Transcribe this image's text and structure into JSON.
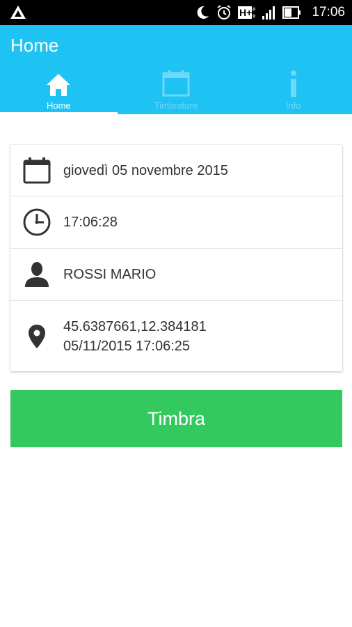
{
  "status_bar": {
    "time": "17:06",
    "network": "H+"
  },
  "app_bar": {
    "title": "Home"
  },
  "tabs": [
    {
      "label": "Home",
      "icon": "home-icon",
      "active": true
    },
    {
      "label": "Timbrature",
      "icon": "calendar-icon",
      "active": false
    },
    {
      "label": "Info",
      "icon": "info-icon",
      "active": false
    }
  ],
  "card": {
    "date": "giovedì 05 novembre 2015",
    "time": "17:06:28",
    "user": "ROSSI MARIO",
    "coordinates": "45.6387661,12.384181",
    "location_time": "05/11/2015 17:06:25"
  },
  "action": {
    "button_label": "Timbra"
  },
  "colors": {
    "app_bar": "#1ec3f4",
    "button": "#34c95f",
    "status_bar": "#000000"
  }
}
